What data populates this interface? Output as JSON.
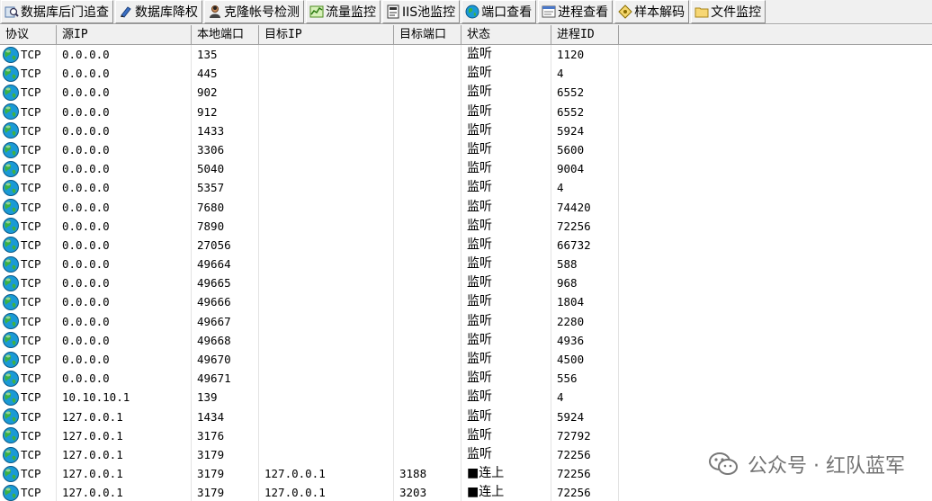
{
  "toolbar": {
    "buttons": [
      {
        "label": "数据库后门追查",
        "icon": "database-search-icon"
      },
      {
        "label": "数据库降权",
        "icon": "database-downgrade-icon"
      },
      {
        "label": "克隆帐号检测",
        "icon": "user-clone-icon"
      },
      {
        "label": "流量监控",
        "icon": "traffic-monitor-icon"
      },
      {
        "label": "IIS池监控",
        "icon": "iis-pool-icon"
      },
      {
        "label": "端口查看",
        "icon": "port-globe-icon"
      },
      {
        "label": "进程查看",
        "icon": "process-view-icon"
      },
      {
        "label": "样本解码",
        "icon": "sample-decode-icon"
      },
      {
        "label": "文件监控",
        "icon": "folder-monitor-icon"
      }
    ]
  },
  "table": {
    "columns": [
      "协议",
      "源IP",
      "本地端口",
      "目标IP",
      "目标端口",
      "状态",
      "进程ID"
    ],
    "rows": [
      [
        "TCP",
        "0.0.0.0",
        "135",
        "",
        "",
        "监听",
        "1120"
      ],
      [
        "TCP",
        "0.0.0.0",
        "445",
        "",
        "",
        "监听",
        "4"
      ],
      [
        "TCP",
        "0.0.0.0",
        "902",
        "",
        "",
        "监听",
        "6552"
      ],
      [
        "TCP",
        "0.0.0.0",
        "912",
        "",
        "",
        "监听",
        "6552"
      ],
      [
        "TCP",
        "0.0.0.0",
        "1433",
        "",
        "",
        "监听",
        "5924"
      ],
      [
        "TCP",
        "0.0.0.0",
        "3306",
        "",
        "",
        "监听",
        "5600"
      ],
      [
        "TCP",
        "0.0.0.0",
        "5040",
        "",
        "",
        "监听",
        "9004"
      ],
      [
        "TCP",
        "0.0.0.0",
        "5357",
        "",
        "",
        "监听",
        "4"
      ],
      [
        "TCP",
        "0.0.0.0",
        "7680",
        "",
        "",
        "监听",
        "74420"
      ],
      [
        "TCP",
        "0.0.0.0",
        "7890",
        "",
        "",
        "监听",
        "72256"
      ],
      [
        "TCP",
        "0.0.0.0",
        "27056",
        "",
        "",
        "监听",
        "66732"
      ],
      [
        "TCP",
        "0.0.0.0",
        "49664",
        "",
        "",
        "监听",
        "588"
      ],
      [
        "TCP",
        "0.0.0.0",
        "49665",
        "",
        "",
        "监听",
        "968"
      ],
      [
        "TCP",
        "0.0.0.0",
        "49666",
        "",
        "",
        "监听",
        "1804"
      ],
      [
        "TCP",
        "0.0.0.0",
        "49667",
        "",
        "",
        "监听",
        "2280"
      ],
      [
        "TCP",
        "0.0.0.0",
        "49668",
        "",
        "",
        "监听",
        "4936"
      ],
      [
        "TCP",
        "0.0.0.0",
        "49670",
        "",
        "",
        "监听",
        "4500"
      ],
      [
        "TCP",
        "0.0.0.0",
        "49671",
        "",
        "",
        "监听",
        "556"
      ],
      [
        "TCP",
        "10.10.10.1",
        "139",
        "",
        "",
        "监听",
        "4"
      ],
      [
        "TCP",
        "127.0.0.1",
        "1434",
        "",
        "",
        "监听",
        "5924"
      ],
      [
        "TCP",
        "127.0.0.1",
        "3176",
        "",
        "",
        "监听",
        "72792"
      ],
      [
        "TCP",
        "127.0.0.1",
        "3179",
        "",
        "",
        "监听",
        "72256"
      ],
      [
        "TCP",
        "127.0.0.1",
        "3179",
        "127.0.0.1",
        "3188",
        "■连上",
        "72256"
      ],
      [
        "TCP",
        "127.0.0.1",
        "3179",
        "127.0.0.1",
        "3203",
        "■连上",
        "72256"
      ]
    ]
  },
  "watermark": {
    "text": "公众号 · 红队蓝军",
    "icon": "wechat-icon"
  },
  "colors": {
    "toolbar_bg": "#f0f0f0",
    "globe_sea": "#1a9ad6",
    "globe_land": "#3cb043"
  }
}
